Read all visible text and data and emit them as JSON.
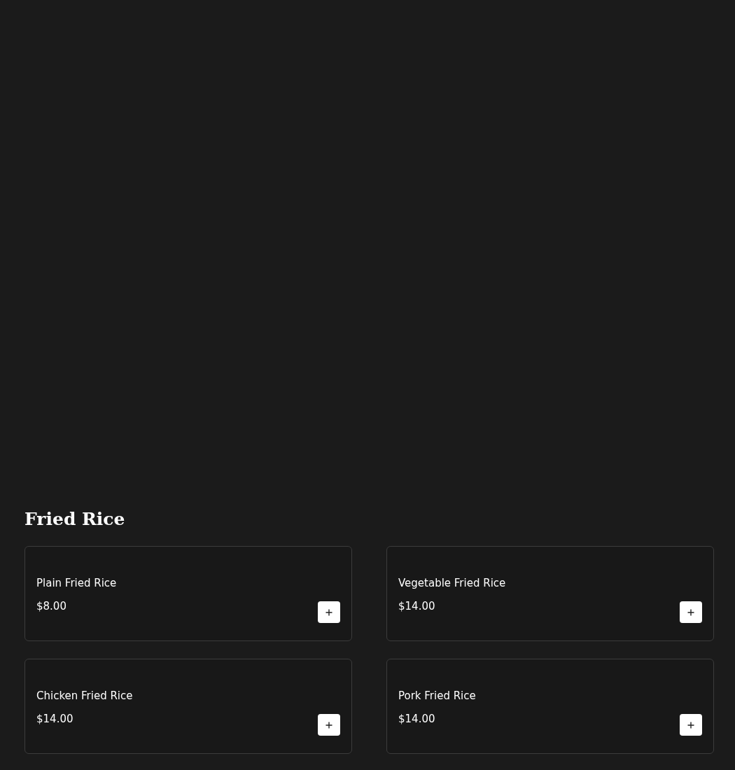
{
  "section": {
    "title": "Fried Rice"
  },
  "items": [
    {
      "name": "Plain Fried Rice",
      "price": "$8.00"
    },
    {
      "name": "Vegetable Fried Rice",
      "price": "$14.00"
    },
    {
      "name": "Chicken Fried Rice",
      "price": "$14.00"
    },
    {
      "name": "Pork Fried Rice",
      "price": "$14.00"
    }
  ]
}
